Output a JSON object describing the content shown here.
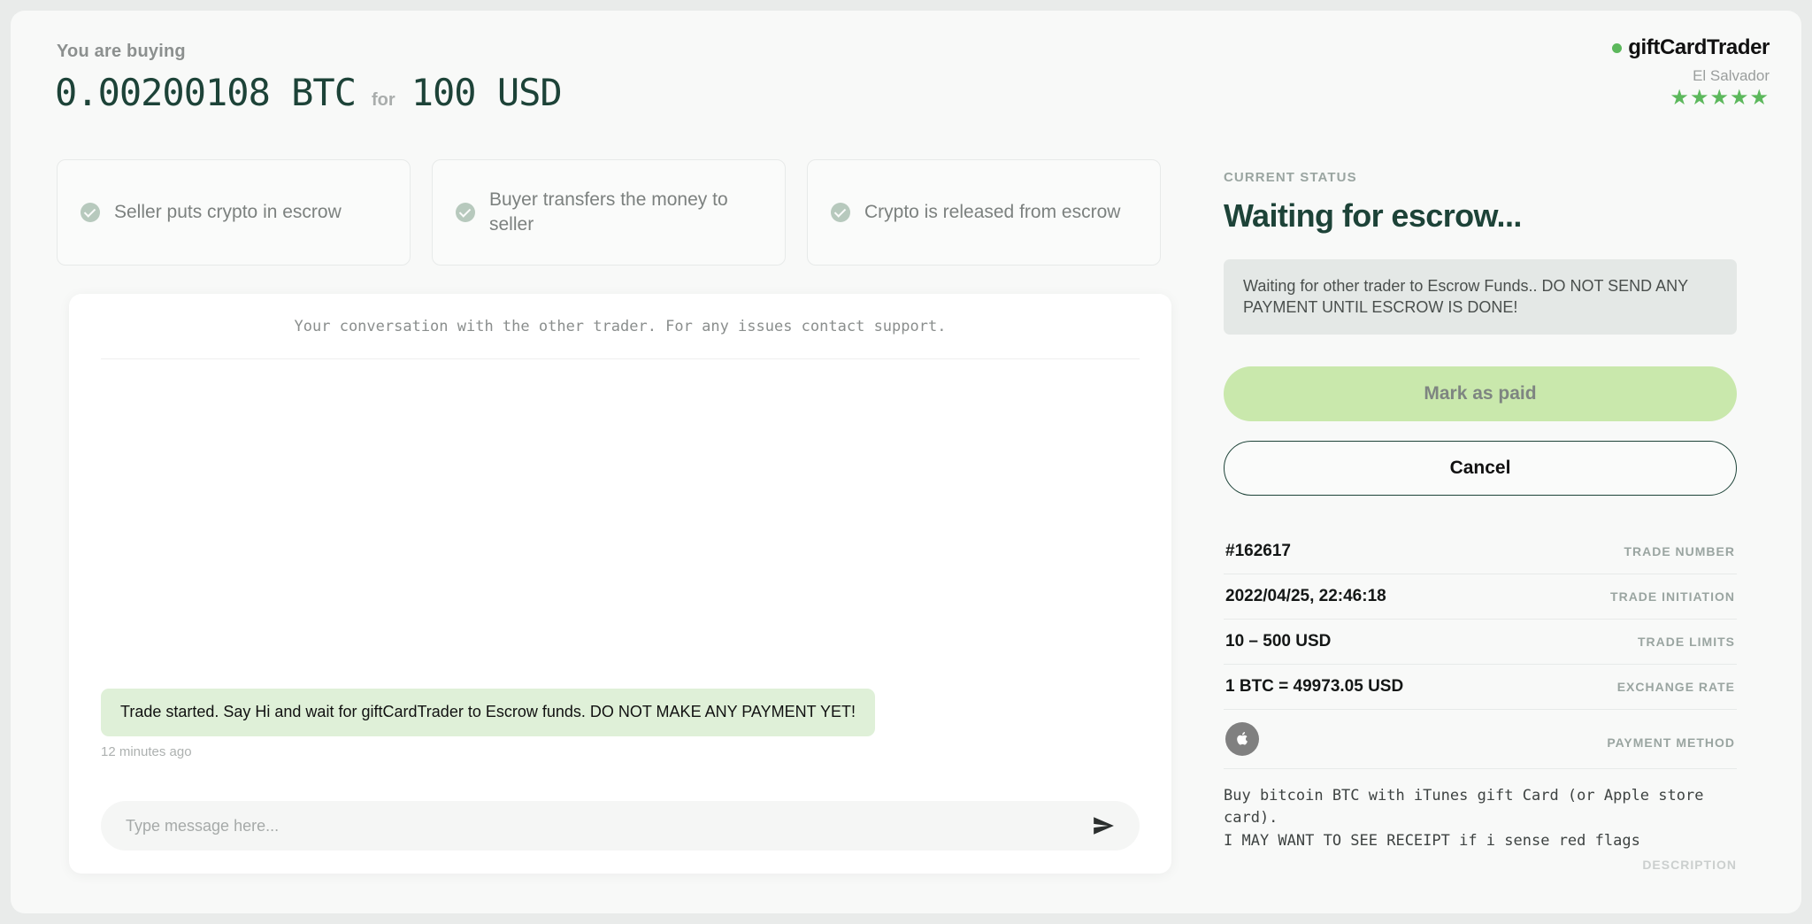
{
  "header": {
    "buying_label": "You are buying",
    "crypto_amount": "0.00200108 BTC",
    "for_label": "for",
    "fiat_amount": "100 USD"
  },
  "brand": {
    "name": "giftCardTrader",
    "country": "El Salvador",
    "stars": "★★★★★",
    "dot_color": "#5cb85c",
    "star_color": "#5cb85c"
  },
  "steps": [
    {
      "label": "Seller puts crypto in escrow"
    },
    {
      "label": "Buyer transfers the money to seller"
    },
    {
      "label": "Crypto is released from escrow"
    }
  ],
  "chat": {
    "header_note": "Your conversation with the other trader. For any issues contact support.",
    "messages": [
      {
        "text": "Trade started. Say Hi and wait for giftCardTrader to Escrow funds. DO NOT MAKE ANY PAYMENT YET!",
        "time": "12 minutes ago",
        "bubble_color": "#dff0d8"
      }
    ],
    "input_placeholder": "Type message here...",
    "input_value": "",
    "send_icon": "send-paper-plane-icon"
  },
  "status": {
    "label": "CURRENT STATUS",
    "title": "Waiting for escrow...",
    "note": "Waiting for other trader to Escrow Funds.. DO NOT SEND ANY PAYMENT UNTIL ESCROW IS DONE!",
    "title_color": "#1d4338"
  },
  "actions": {
    "mark_as_paid": "Mark as paid",
    "cancel": "Cancel",
    "mark_as_paid_color": "#c9e8ac"
  },
  "details": [
    {
      "value": "#162617",
      "key": "TRADE NUMBER"
    },
    {
      "value": "2022/04/25, 22:46:18",
      "key": "TRADE INITIATION"
    },
    {
      "value": "10 – 500 USD",
      "key": "TRADE LIMITS"
    },
    {
      "value": "1 BTC = 49973.05 USD",
      "key": "EXCHANGE RATE"
    }
  ],
  "payment_method": {
    "icon": "apple-logo-icon",
    "key": "PAYMENT METHOD",
    "icon_bg": "#808080"
  },
  "description": {
    "text": "Buy bitcoin BTC with iTunes gift Card (or Apple store card).\nI MAY WANT TO SEE RECEIPT if i sense red flags",
    "key": "DESCRIPTION"
  }
}
